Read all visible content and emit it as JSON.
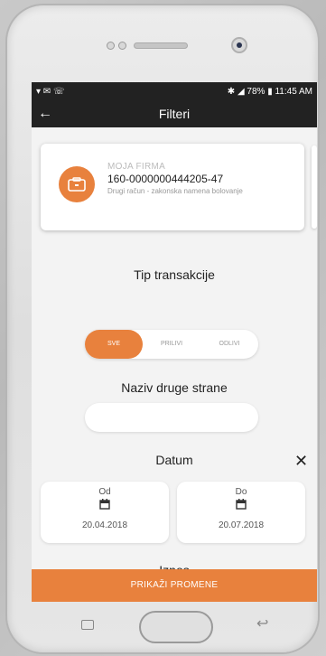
{
  "statusbar": {
    "left_icons": "▾ ✉ ☏",
    "right": "✱ ◢ 78% ▮ 11:45 AM"
  },
  "appbar": {
    "title": "Filteri",
    "back_icon": "arrow-left-icon"
  },
  "account_card": {
    "company": "MOJA FIRMA",
    "account": "160-0000000444205-47",
    "description": "Drugi račun - zakonska namena bolovanje",
    "icon": "wallet-icon",
    "accent": "#e8813d"
  },
  "transaction_type": {
    "title": "Tip transakcije",
    "options": [
      "SVE",
      "PRILIVI",
      "ODLIVI"
    ],
    "selected": "SVE"
  },
  "counterparty": {
    "title": "Naziv druge strane",
    "value": ""
  },
  "date": {
    "title": "Datum",
    "from_label": "Od",
    "from_value": "20.04.2018",
    "to_label": "Do",
    "to_value": "20.07.2018"
  },
  "amount": {
    "title": "Iznos",
    "prev": "<",
    "next": ">"
  },
  "cta": {
    "label": "PRIKAŽI PROMENE"
  },
  "colors": {
    "accent": "#e8813d",
    "bar": "#222222"
  }
}
